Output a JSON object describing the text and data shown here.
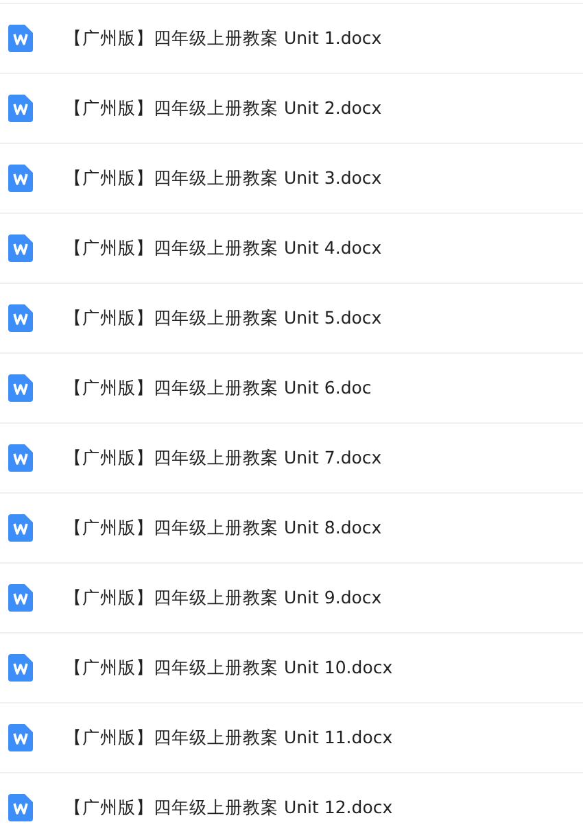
{
  "files": [
    {
      "name": "【广州版】四年级上册教案 Unit 1.docx"
    },
    {
      "name": "【广州版】四年级上册教案 Unit 2.docx"
    },
    {
      "name": "【广州版】四年级上册教案 Unit 3.docx"
    },
    {
      "name": "【广州版】四年级上册教案 Unit 4.docx"
    },
    {
      "name": "【广州版】四年级上册教案 Unit 5.docx"
    },
    {
      "name": "【广州版】四年级上册教案 Unit 6.doc"
    },
    {
      "name": "【广州版】四年级上册教案 Unit 7.docx"
    },
    {
      "name": "【广州版】四年级上册教案 Unit 8.docx"
    },
    {
      "name": "【广州版】四年级上册教案 Unit 9.docx"
    },
    {
      "name": "【广州版】四年级上册教案 Unit 10.docx"
    },
    {
      "name": "【广州版】四年级上册教案 Unit 11.docx"
    },
    {
      "name": "【广州版】四年级上册教案 Unit 12.docx"
    }
  ]
}
